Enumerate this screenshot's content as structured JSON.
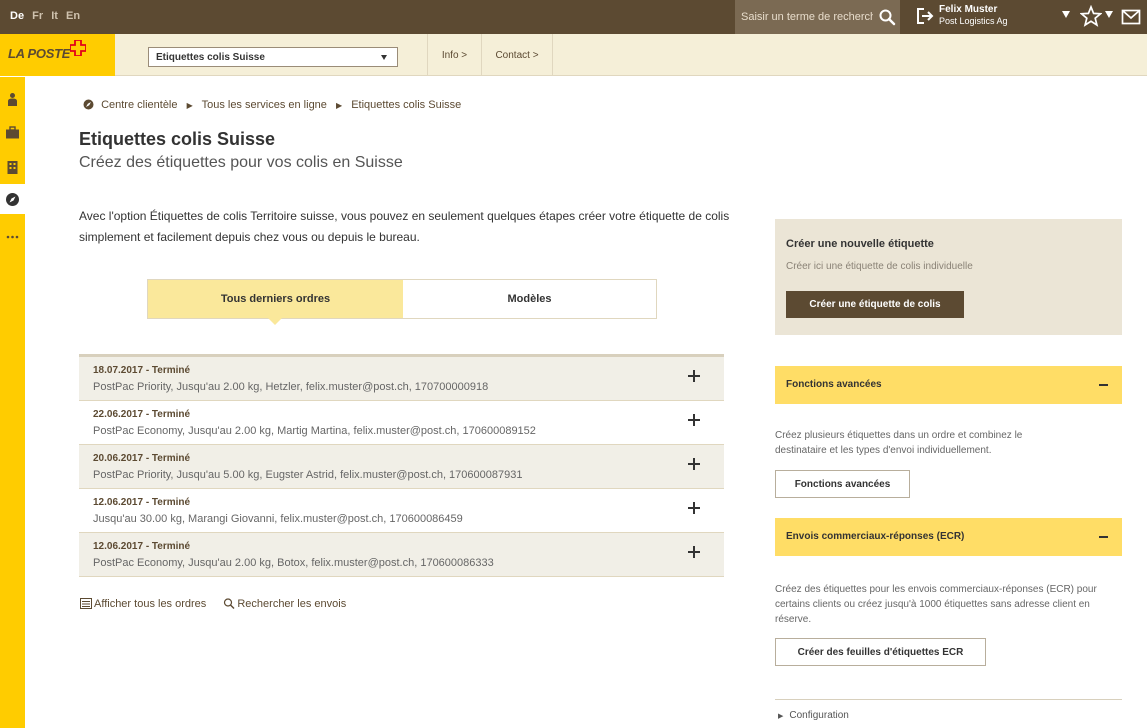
{
  "topbar": {
    "languages": [
      {
        "label": "De",
        "active": true
      },
      {
        "label": "Fr",
        "active": false
      },
      {
        "label": "It",
        "active": false
      },
      {
        "label": "En",
        "active": false
      }
    ],
    "search_placeholder": "Saisir un terme de recherche",
    "user_name": "Felix Muster",
    "user_company": "Post Logistics Ag"
  },
  "navbar": {
    "logo": "LA POSTE",
    "service_select": "Etiquettes colis Suisse",
    "info": "Info >",
    "contact": "Contact >"
  },
  "breadcrumb": {
    "items": [
      "Centre clientèle",
      "Tous les services en ligne",
      "Etiquettes colis Suisse"
    ]
  },
  "main": {
    "title": "Etiquettes colis Suisse",
    "subtitle": "Créez des étiquettes pour vos colis en Suisse",
    "intro": "Avec l'option Étiquettes de colis Territoire suisse, vous pouvez en seulement quelques étapes créer votre étiquette de colis simplement et facilement depuis chez vous ou depuis le bureau.",
    "tabs": [
      "Tous derniers ordres",
      "Modèles"
    ],
    "orders": [
      {
        "date": "18.07.2017 - Terminé",
        "desc": "PostPac Priority, Jusqu'au 2.00 kg, Hetzler, felix.muster@post.ch, 170700000918"
      },
      {
        "date": "22.06.2017 - Terminé",
        "desc": "PostPac Economy, Jusqu'au 2.00 kg, Martig Martina, felix.muster@post.ch, 170600089152"
      },
      {
        "date": "20.06.2017 - Terminé",
        "desc": "PostPac Priority, Jusqu'au 5.00 kg, Eugster Astrid, felix.muster@post.ch, 170600087931"
      },
      {
        "date": "12.06.2017 - Terminé",
        "desc": "Jusqu'au 30.00 kg, Marangi Giovanni, felix.muster@post.ch, 170600086459"
      },
      {
        "date": "12.06.2017 - Terminé",
        "desc": "PostPac Economy, Jusqu'au 2.00 kg, Botox, felix.muster@post.ch, 170600086333"
      }
    ],
    "show_all_orders": "Afficher tous les ordres",
    "search_shipments": "Rechercher les envois"
  },
  "sidebar": {
    "new_label_title": "Créer une nouvelle étiquette",
    "new_label_text": "Créer ici une étiquette de colis individuelle",
    "new_label_button": "Créer une étiquette de colis",
    "advanced_title": "Fonctions avancées",
    "advanced_text": "Créez plusieurs étiquettes dans un ordre et combinez le destinataire et les types d'envoi individuellement.",
    "advanced_button": "Fonctions avancées",
    "ecr_title": "Envois commerciaux-réponses (ECR)",
    "ecr_text": "Créez des étiquettes pour les envois commerciaux-réponses (ECR) pour certains clients ou créez jusqu'à 1000 étiquettes sans adresse client en réserve.",
    "ecr_button": "Créer des feuilles d'étiquettes ECR",
    "configuration": "Configuration"
  },
  "colors": {
    "brand_yellow": "#ffcc00",
    "brand_brown": "#5c4a32",
    "accordion_yellow": "#ffdd66",
    "tab_active": "#fae89b"
  }
}
